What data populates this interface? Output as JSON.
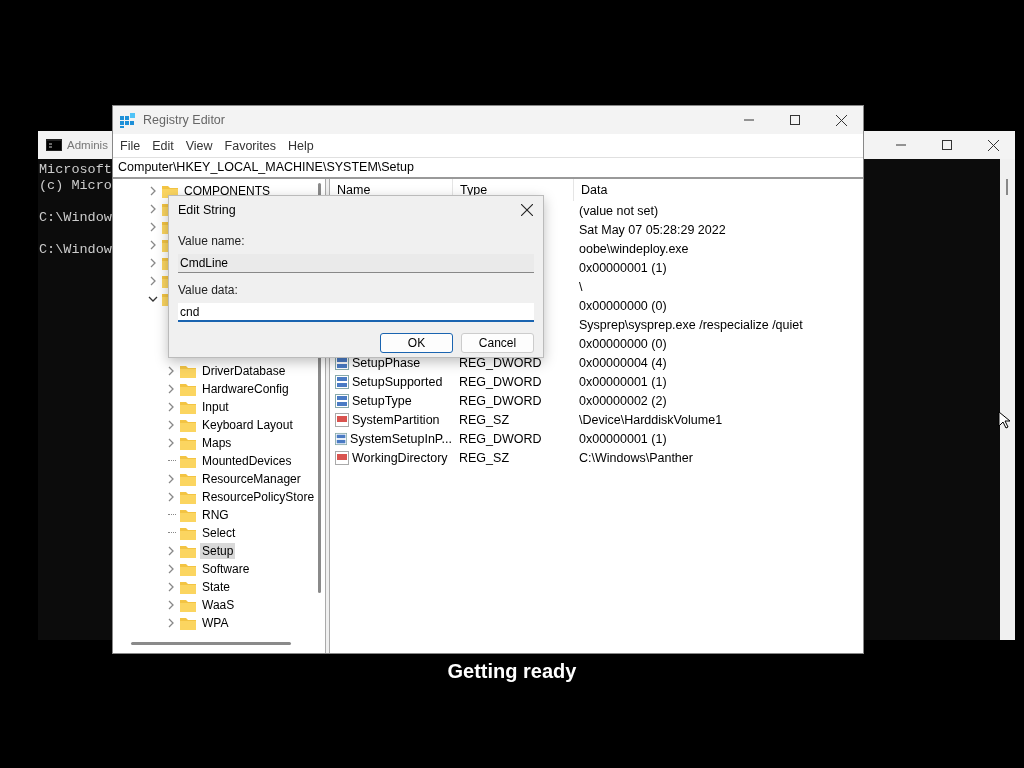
{
  "console": {
    "title": "Adminis",
    "blocks": [
      [
        "Microsoft",
        "(c) Micro"
      ],
      [
        "C:\\Window"
      ],
      [
        "C:\\Window"
      ]
    ]
  },
  "regedit": {
    "title": "Registry Editor",
    "menu": [
      "File",
      "Edit",
      "View",
      "Favorites",
      "Help"
    ],
    "address": "Computer\\HKEY_LOCAL_MACHINE\\SYSTEM\\Setup",
    "tree": [
      {
        "label": "COMPONENTS",
        "leaf": false,
        "expanded": false,
        "selected": false
      },
      {
        "leaf": false,
        "expanded": false
      },
      {
        "leaf": false,
        "expanded": false
      },
      {
        "leaf": false,
        "expanded": false
      },
      {
        "leaf": false,
        "expanded": false
      },
      {
        "leaf": false,
        "expanded": false
      },
      {
        "leaf": false,
        "expanded": true,
        "children": [
          {
            "label": "DriverDatabase",
            "leaf": false,
            "expanded": false,
            "selected": false
          },
          {
            "label": "HardwareConfig",
            "leaf": false,
            "expanded": false,
            "selected": false
          },
          {
            "label": "Input",
            "leaf": false,
            "expanded": false,
            "selected": false
          },
          {
            "label": "Keyboard Layout",
            "leaf": false,
            "expanded": false,
            "selected": false
          },
          {
            "label": "Maps",
            "leaf": false,
            "expanded": false,
            "selected": false
          },
          {
            "label": "MountedDevices",
            "leaf": true,
            "selected": false
          },
          {
            "label": "ResourceManager",
            "leaf": false,
            "expanded": false,
            "selected": false
          },
          {
            "label": "ResourcePolicyStore",
            "leaf": false,
            "expanded": false,
            "selected": false
          },
          {
            "label": "RNG",
            "leaf": true,
            "selected": false
          },
          {
            "label": "Select",
            "leaf": true,
            "selected": false
          },
          {
            "label": "Setup",
            "leaf": false,
            "expanded": false,
            "selected": true
          },
          {
            "label": "Software",
            "leaf": false,
            "expanded": false,
            "selected": false
          },
          {
            "label": "State",
            "leaf": false,
            "expanded": false,
            "selected": false
          },
          {
            "label": "WaaS",
            "leaf": false,
            "expanded": false,
            "selected": false
          },
          {
            "label": "WPA",
            "leaf": false,
            "expanded": false,
            "selected": false
          }
        ]
      }
    ],
    "columns": [
      "Name",
      "Type",
      "Data"
    ],
    "values": [
      {
        "data": "(value not set)"
      },
      {
        "data": "Sat May 07 05:28:29 2022"
      },
      {
        "data": "oobe\\windeploy.exe"
      },
      {
        "data": "0x00000001 (1)"
      },
      {
        "data": "\\"
      },
      {
        "data": "0x00000000 (0)"
      },
      {
        "data": "Sysprep\\sysprep.exe /respecialize /quiet"
      },
      {
        "data": "0x00000000 (0)"
      },
      {
        "kind": "dword",
        "name": "SetupPhase",
        "type": "REG_DWORD",
        "data": "0x00000004 (4)"
      },
      {
        "kind": "dword",
        "name": "SetupSupported",
        "type": "REG_DWORD",
        "data": "0x00000001 (1)"
      },
      {
        "kind": "dword",
        "name": "SetupType",
        "type": "REG_DWORD",
        "data": "0x00000002 (2)"
      },
      {
        "kind": "string",
        "name": "SystemPartition",
        "type": "REG_SZ",
        "data": "\\Device\\HarddiskVolume1"
      },
      {
        "kind": "dword",
        "name": "SystemSetupInP...",
        "type": "REG_DWORD",
        "data": "0x00000001 (1)"
      },
      {
        "kind": "string",
        "name": "WorkingDirectory",
        "type": "REG_SZ",
        "data": "C:\\Windows\\Panther"
      }
    ]
  },
  "dialog": {
    "title": "Edit String",
    "name_label": "Value name:",
    "name_value": "CmdLine",
    "data_label": "Value data:",
    "data_value": "cnd",
    "buttons": [
      "OK",
      "Cancel"
    ]
  },
  "status": "Getting ready"
}
